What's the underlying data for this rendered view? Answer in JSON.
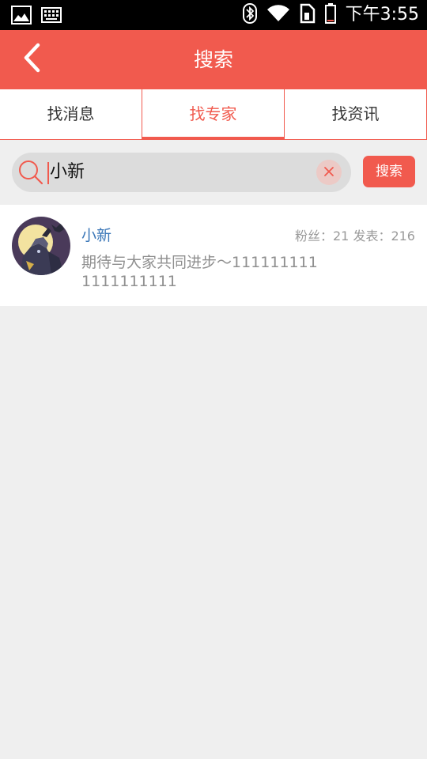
{
  "status_bar": {
    "time": "下午3:55",
    "icons": [
      "image-icon",
      "keyboard-icon",
      "bluetooth-icon",
      "wifi-icon",
      "sim-icon",
      "battery-icon"
    ]
  },
  "header": {
    "title": "搜索",
    "back_icon": "chevron-left-icon"
  },
  "tabs": [
    {
      "label": "找消息",
      "active": false
    },
    {
      "label": "找专家",
      "active": true
    },
    {
      "label": "找资讯",
      "active": false
    }
  ],
  "search": {
    "value": "小新",
    "placeholder": "",
    "button_label": "搜索"
  },
  "results": [
    {
      "name": "小新",
      "stats": "粉丝：21 发表：216",
      "description": "期待与大家共同进步～1111111111111111111"
    }
  ],
  "colors": {
    "accent": "#f15a4e",
    "name_link": "#3b77b8",
    "background": "#efefef"
  }
}
